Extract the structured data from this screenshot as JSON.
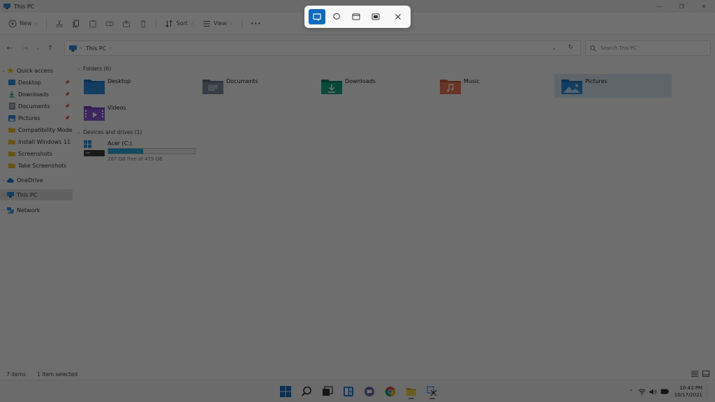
{
  "window": {
    "title": "This PC"
  },
  "toolbar": {
    "new_label": "New",
    "sort_label": "Sort",
    "view_label": "View",
    "more_label": "···"
  },
  "address": {
    "crumb": "This PC",
    "search_placeholder": "Search This PC"
  },
  "sidebar": {
    "quick_access_label": "Quick access",
    "quick_items": [
      {
        "label": "Desktop",
        "icon": "desktop-folder-icon",
        "pinned": true
      },
      {
        "label": "Downloads",
        "icon": "downloads-folder-icon",
        "pinned": true
      },
      {
        "label": "Documents",
        "icon": "documents-folder-icon",
        "pinned": true
      },
      {
        "label": "Pictures",
        "icon": "pictures-folder-icon",
        "pinned": true
      },
      {
        "label": "Compatibility Mode",
        "icon": "folder-icon",
        "pinned": false
      },
      {
        "label": "Install Windows 11",
        "icon": "folder-icon",
        "pinned": false
      },
      {
        "label": "Screenshots",
        "icon": "folder-icon",
        "pinned": false
      },
      {
        "label": "Take Screenshots",
        "icon": "folder-icon",
        "pinned": false
      }
    ],
    "onedrive_label": "OneDrive",
    "thispc_label": "This PC",
    "network_label": "Network"
  },
  "content": {
    "folders_header": "Folders (6)",
    "folders": [
      {
        "name": "Desktop",
        "icon": "desktop-folder-icon"
      },
      {
        "name": "Documents",
        "icon": "documents-folder-icon"
      },
      {
        "name": "Downloads",
        "icon": "downloads-folder-icon"
      },
      {
        "name": "Music",
        "icon": "music-folder-icon"
      },
      {
        "name": "Pictures",
        "icon": "pictures-folder-icon",
        "selected": true
      },
      {
        "name": "Videos",
        "icon": "videos-folder-icon"
      }
    ],
    "drives_header": "Devices and drives (1)",
    "drive": {
      "name": "Acer (C:)",
      "free_text": "287 GB free of 475 GB",
      "used_fraction": 0.4
    }
  },
  "status": {
    "items_count": "7 items",
    "selection": "1 item selected"
  },
  "snipping_toolbar": {
    "modes": [
      "rectangular-snip",
      "freeform-snip",
      "window-snip",
      "fullscreen-snip"
    ],
    "active_mode": "rectangular-snip"
  },
  "taskbar": {
    "apps": [
      "start-icon",
      "search-icon",
      "task-view-icon",
      "widgets-icon",
      "chat-icon",
      "chrome-icon",
      "file-explorer-icon",
      "snipping-tool-icon"
    ],
    "time": "10:43 PM",
    "date": "10/17/2021"
  },
  "colors": {
    "accent": "#0f6cbd",
    "drive_bar": "#26a0da",
    "selection": "#d4dfe8"
  }
}
